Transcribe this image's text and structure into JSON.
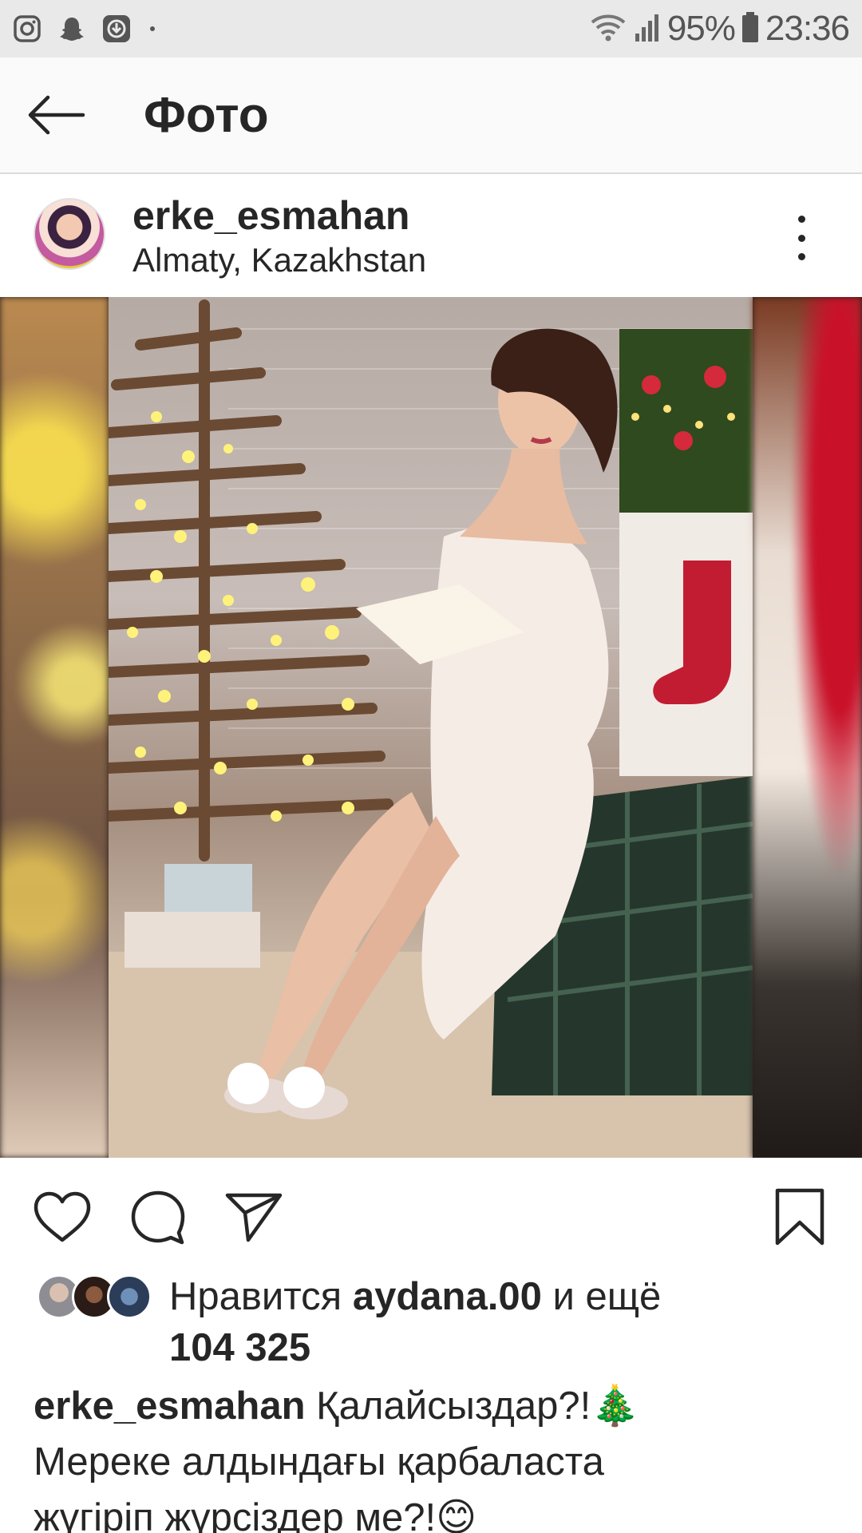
{
  "status_bar": {
    "icons_left": [
      "instagram-icon",
      "snapchat-icon",
      "download-icon"
    ],
    "battery_percent": "95%",
    "time": "23:36"
  },
  "app_bar": {
    "back_icon": "arrow-left-icon",
    "title": "Фото"
  },
  "post": {
    "username": "erke_esmahan",
    "location": "Almaty, Kazakhstan",
    "more_icon": "more-vertical-icon"
  },
  "actions": {
    "like_icon": "heart-icon",
    "comment_icon": "comment-icon",
    "share_icon": "send-icon",
    "save_icon": "bookmark-icon"
  },
  "likes": {
    "prefix": "Нравится ",
    "user": "aydana.00",
    "middle": " и ещё",
    "count": "104 325"
  },
  "caption": {
    "username": "erke_esmahan",
    "line1": " Қалайсыздар?!🎄",
    "line2": "Мереке алдындағы қарбаласта",
    "line3": "жүгіріп жүрсіздер ме?!😊"
  }
}
